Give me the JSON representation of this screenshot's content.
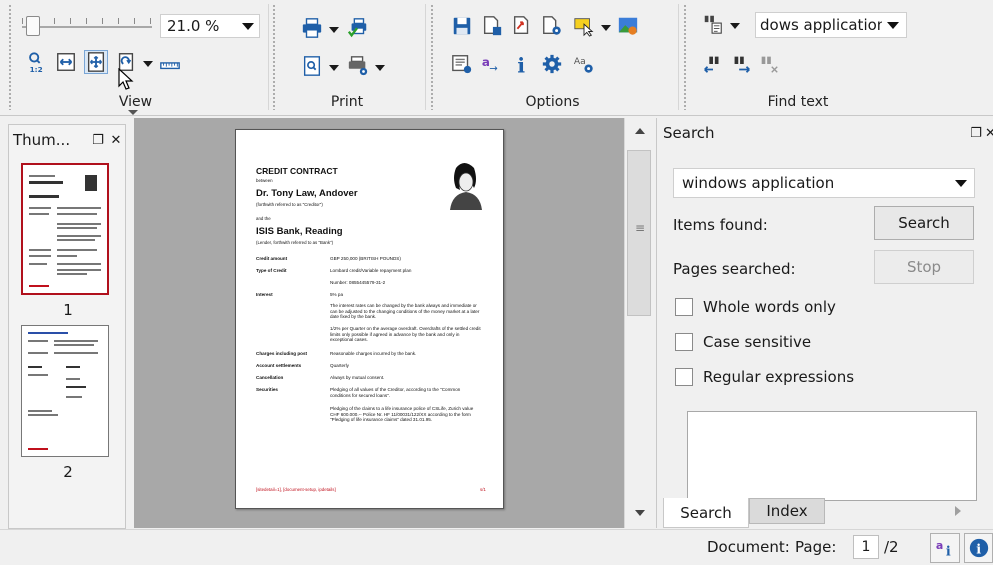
{
  "toolbar": {
    "view": {
      "label": "View",
      "zoom_value": "21.0 %"
    },
    "print": {
      "label": "Print"
    },
    "options": {
      "label": "Options"
    },
    "find": {
      "label": "Find text",
      "search_value": "dows application"
    }
  },
  "thumbnails": {
    "title": "Thum...",
    "pages": [
      {
        "number": "1"
      },
      {
        "number": "2"
      }
    ]
  },
  "document": {
    "title": "CREDIT CONTRACT",
    "between": "between",
    "party1": "Dr. Tony Law, Andover",
    "party1_note": "(forthwith referred to as \"Creditor\")",
    "and": "and the",
    "party2": "ISIS Bank, Reading",
    "party2_note": "(Lender, forthwith referred to as \"Bank\")",
    "rows": [
      {
        "key": "Credit amount",
        "value": "GBP 250,000 (BRITISH POUNDS)"
      },
      {
        "key": "Type of Credit",
        "value": "Lombard credit/Variable repayment plan"
      },
      {
        "key": "",
        "value": "Number: 0855445579-31-2"
      },
      {
        "key": "Interest",
        "value": "5% pa"
      },
      {
        "key": "",
        "value": "The interest rates can be changed by the bank always and immediate or can be adjusted to the changing conditions of the money market at a later date fixed by the bank."
      },
      {
        "key": "",
        "value": "1/2% per Quarter on the average overdraft. Overdrafts of the settled credit limits only possible if agreed in advance by the bank and only in exceptional cases."
      },
      {
        "key": "Charges including post",
        "value": "Reasonable charges incurred by the bank."
      },
      {
        "key": "Account settlements",
        "value": "Quarterly"
      },
      {
        "key": "Cancellation",
        "value": "Always by mutual consent."
      },
      {
        "key": "Securities",
        "value": "Pledging of all values of the Creditor, according to the \"Common conditions for secured loans\"."
      },
      {
        "key": "",
        "value": "Pledging of the claims to a life insurance police of CSLife, Zurich value CHF 600.000.-- Police Nr. HF 11/00031/122/XX according to the form \"Pledging of life insurance claims\" dated 31.01.95."
      }
    ],
    "footer_left": "[sitedetail=1], [document-setup, ipdetails]",
    "footer_right": "s/1"
  },
  "search_panel": {
    "title": "Search",
    "combo_value": "windows application",
    "items_found_label": "Items found:",
    "pages_searched_label": "Pages searched:",
    "search_button": "Search",
    "stop_button": "Stop",
    "options": [
      {
        "label": "Whole words only",
        "checked": false
      },
      {
        "label": "Case sensitive",
        "checked": false
      },
      {
        "label": "Regular expressions",
        "checked": false
      }
    ],
    "tabs": {
      "search": "Search",
      "index": "Index"
    }
  },
  "status_bar": {
    "document_label": "Document:",
    "page_label": "Page:",
    "current_page": "1",
    "total_pages": "/2"
  },
  "colors": {
    "selected_thumb_border": "#b0101c",
    "doc_background": "#a8a8a8",
    "accent_blue": "#1f5fa8"
  }
}
